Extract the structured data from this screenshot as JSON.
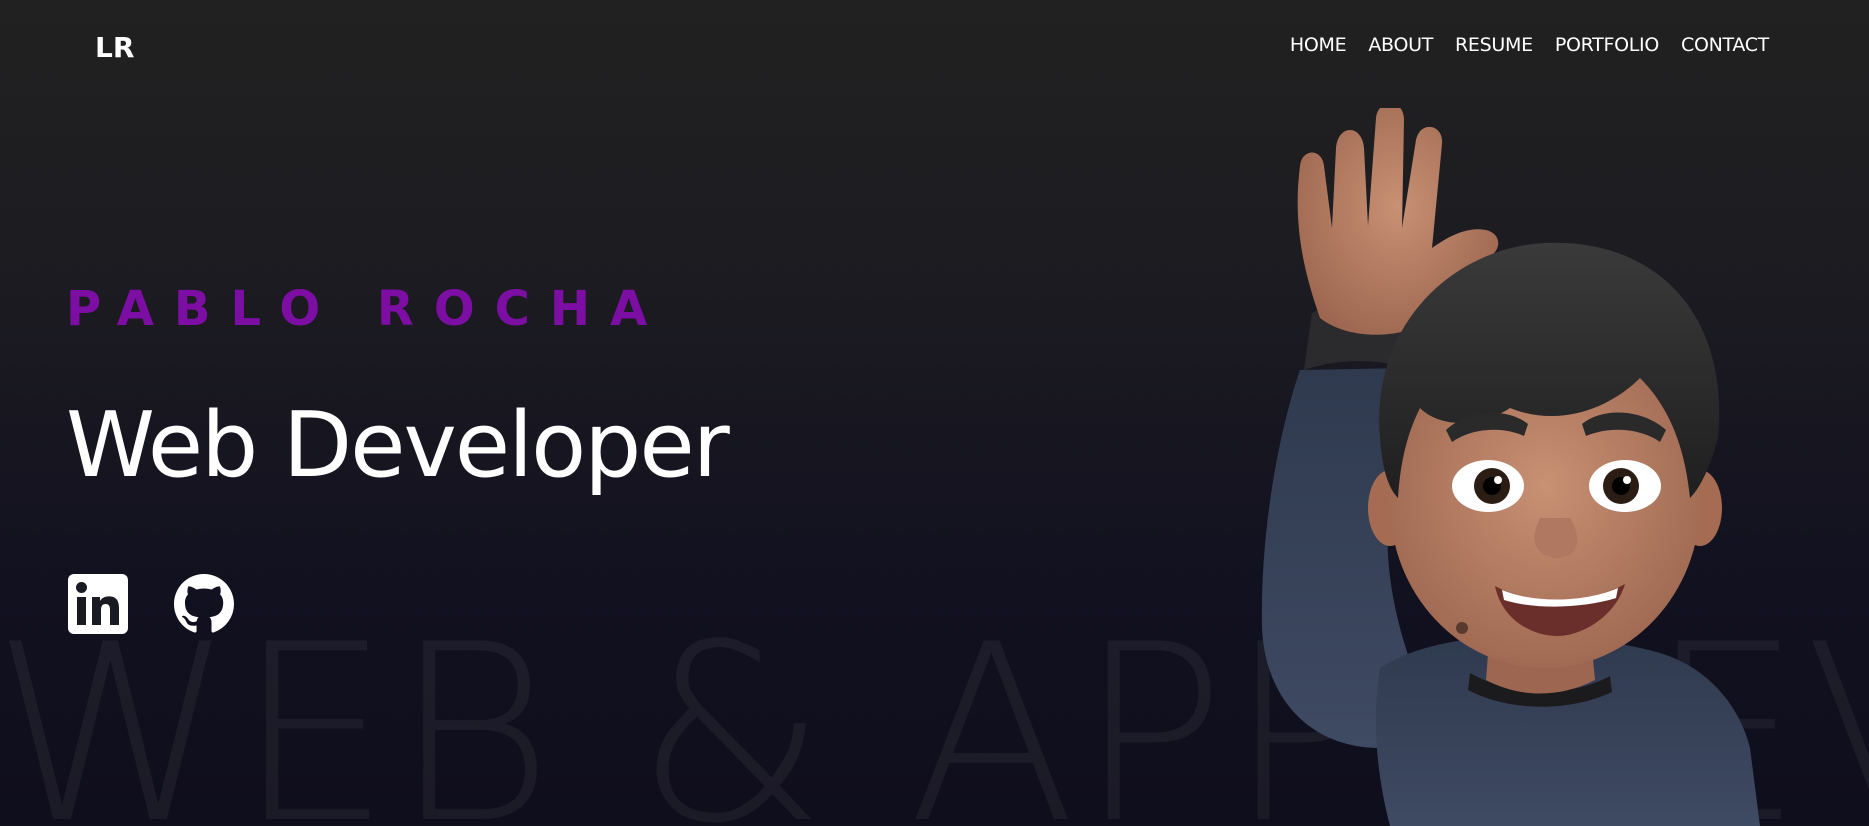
{
  "header": {
    "logo_text": "LR",
    "nav": [
      {
        "label": "HOME"
      },
      {
        "label": "ABOUT"
      },
      {
        "label": "RESUME"
      },
      {
        "label": "PORTFOLIO"
      },
      {
        "label": "CONTACT"
      }
    ]
  },
  "hero": {
    "name": "PABLO ROCHA",
    "role": "Web Developer",
    "background_text": "WEB & APP DEV",
    "socials": [
      {
        "icon": "linkedin-icon"
      },
      {
        "icon": "github-icon"
      }
    ]
  },
  "colors": {
    "accent": "#7d0ea3",
    "background_top": "#212121",
    "background_bottom": "#0f0e1c",
    "text": "#ffffff"
  }
}
